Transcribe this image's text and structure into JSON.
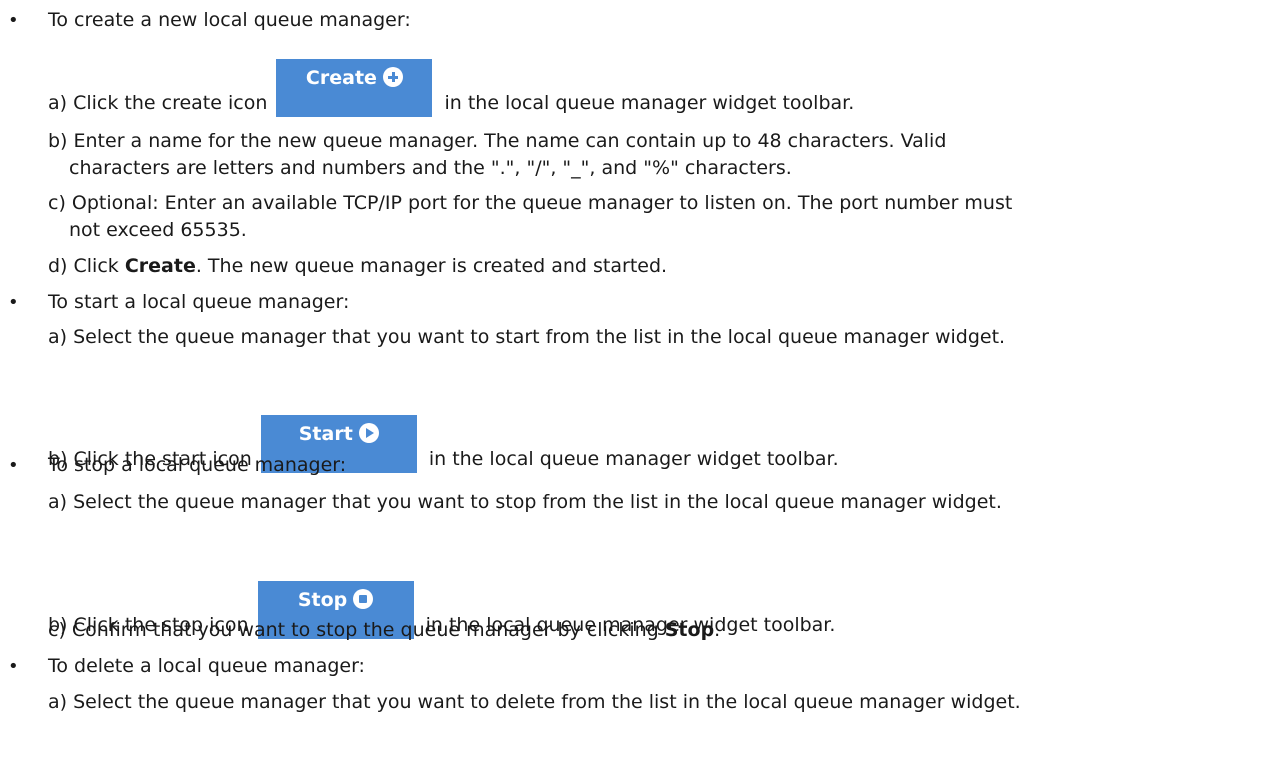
{
  "bullet_char": "•",
  "sections": {
    "create": {
      "heading": "To create a new local queue manager:",
      "step_a_pre": "a) Click the create icon",
      "step_a_post": "in the local queue manager widget toolbar.",
      "button_label": "Create",
      "step_b_line1": "b) Enter a name for the new queue manager. The name can contain up to 48 characters. Valid",
      "step_b_line2": "characters are letters and numbers and the \".\", \"/\", \"_\", and \"%\" characters.",
      "step_c_line1": "c) Optional: Enter an available TCP/IP port for the queue manager to listen on. The port number must",
      "step_c_line2": "not exceed 65535.",
      "step_d_pre": "d) Click",
      "step_d_bold": "Create",
      "step_d_post": ". The new queue manager is created and started."
    },
    "start": {
      "heading": "To start a local queue manager:",
      "step_a": "a) Select the queue manager that you want to start from the list in the local queue manager widget.",
      "step_b_pre": "b) Click the start icon",
      "step_b_post": "in the local queue manager widget toolbar.",
      "button_label": "Start"
    },
    "stop": {
      "heading": "To stop a local queue manager:",
      "step_a": "a) Select the queue manager that you want to stop from the list in the local queue manager widget.",
      "step_b_pre": "b) Click the stop icon",
      "step_b_post": "in the local queue manager widget toolbar.",
      "button_label": "Stop",
      "step_c_pre": "c) Confirm that you want to stop the queue manager by clicking",
      "step_c_bold": "Stop",
      "step_c_post": "."
    },
    "delete": {
      "heading": "To delete a local queue manager:",
      "step_a": "a) Select the queue manager that you want to delete from the list in the local queue manager widget."
    }
  },
  "colors": {
    "button_bg": "#4a8ad4",
    "text": "#1a1a1a"
  },
  "icons": {
    "create": "plus-circle-icon",
    "start": "play-circle-icon",
    "stop": "stop-circle-icon"
  }
}
